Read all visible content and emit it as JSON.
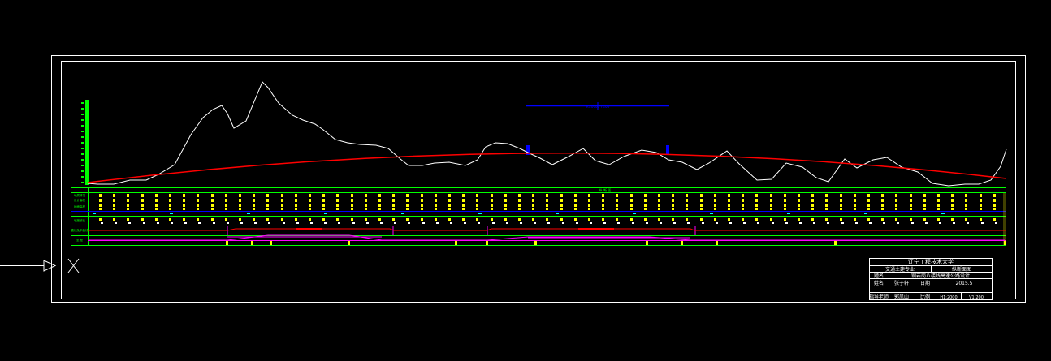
{
  "title_block": {
    "university": "辽宁工程技术大学",
    "major": "交通土建专业",
    "drawing_name": "纵断面图",
    "title_label": "题名",
    "project_title": "铜岩岗八楼线高速公路设计",
    "name_label": "姓名",
    "student_name": "张子轩",
    "date_label": "日期",
    "date_value": "2015.5",
    "advisor_label": "指导老师",
    "advisor_name": "郭凤山",
    "proofread_label": "比例",
    "scale_text": "H1:2000",
    "scale_v": "V1:200"
  },
  "annotations": {
    "vc_label": "R=0000 T=00",
    "band_label": "纵 断 面",
    "pin_label": "X"
  },
  "band_labels": [
    "地质情况",
    "设计高程",
    "地面高程",
    "坡度坡长",
    "直线及平曲线",
    "里 程"
  ],
  "colors": {
    "background": "#000000",
    "frame": "#ffffff",
    "ground": "#ffffff",
    "design": "#ff0000",
    "grid": "#00ff00",
    "labels": "#ffff00",
    "accent": "#0000ff",
    "magenta": "#ff00ff",
    "cyan": "#00ffff"
  }
}
